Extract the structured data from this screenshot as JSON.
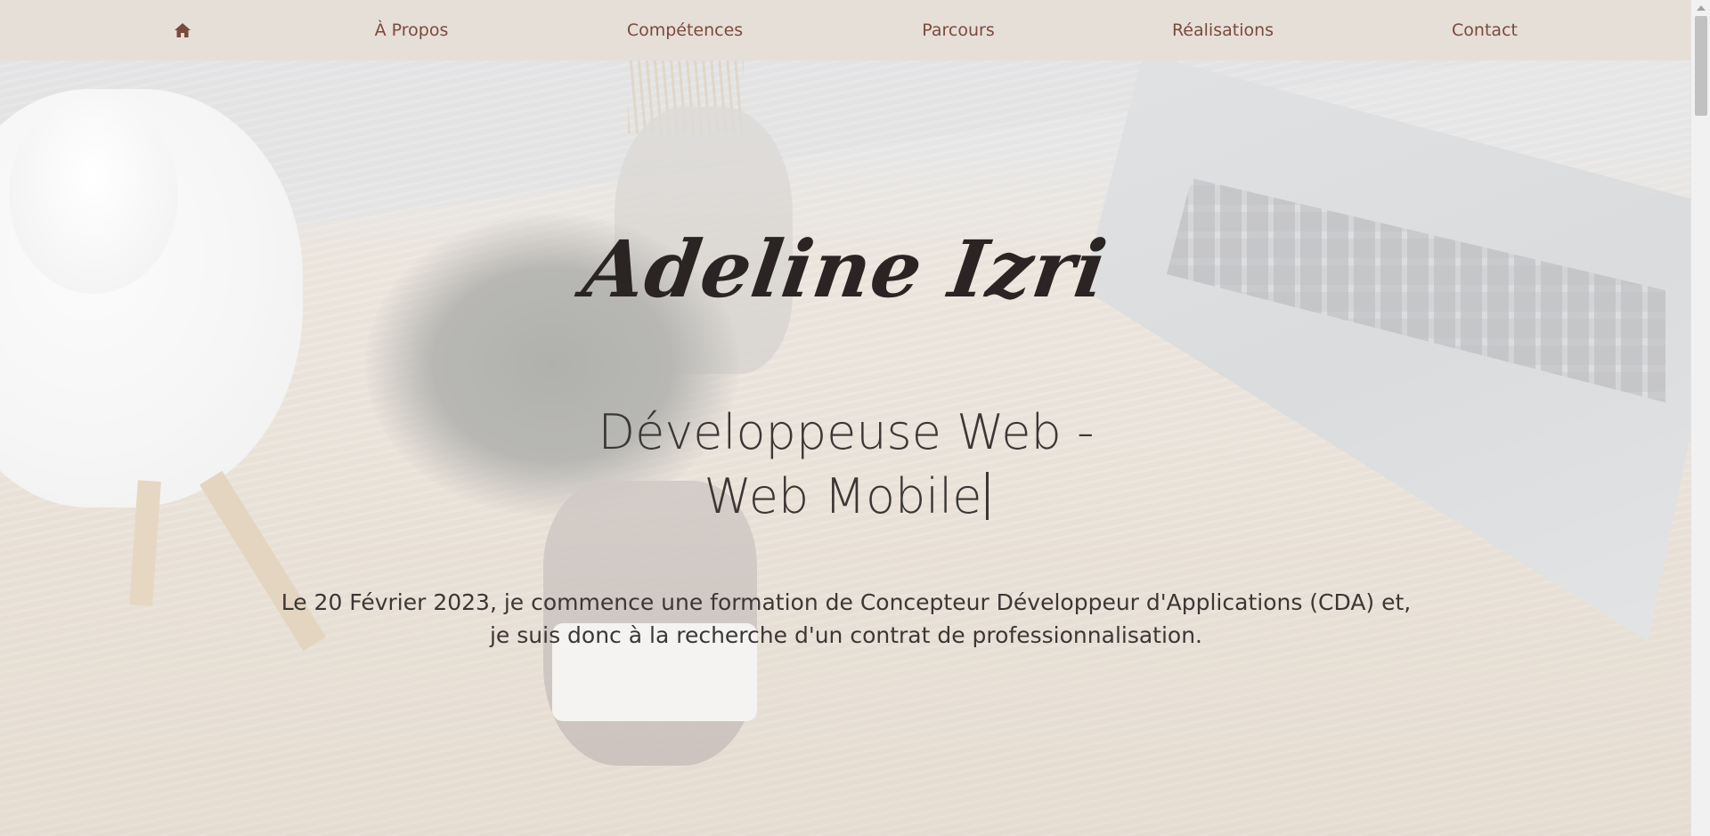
{
  "nav": {
    "home_icon": "home-icon",
    "items": [
      {
        "label": "À Propos"
      },
      {
        "label": "Compétences"
      },
      {
        "label": "Parcours"
      },
      {
        "label": "Réalisations"
      },
      {
        "label": "Contact"
      }
    ]
  },
  "hero": {
    "name": "Adeline Izri",
    "role_line1": "Développeuse Web -",
    "role_line2": "Web Mobile",
    "description_line1": "Le 20 Février 2023, je commence une formation de Concepteur Développeur d'Applications (CDA) et,",
    "description_line2": "je suis donc à la recherche d'un contrat de professionnalisation."
  },
  "colors": {
    "nav_background": "#e6dfd8",
    "nav_text": "#7a4a3a",
    "body_text": "#3a3735",
    "name_text": "#2a2524"
  }
}
